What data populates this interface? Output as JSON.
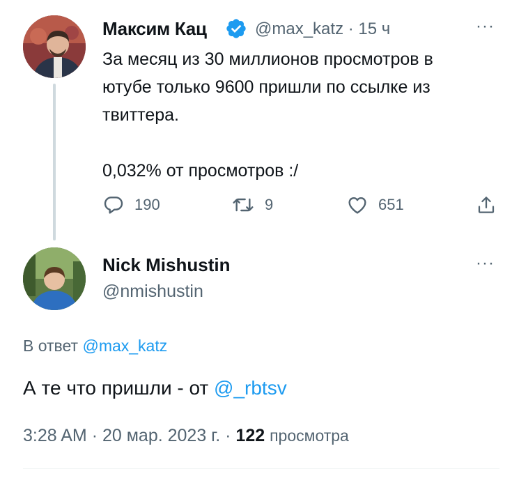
{
  "tweet1": {
    "author_name": "Максим Кац",
    "handle": "@max_katz",
    "separator": "·",
    "time_ago": "15 ч",
    "text": "За месяц из 30 миллионов просмотров в\nютубе только 9600 пришли по ссылке из\nтвиттера.\n\n0,032% от просмотров :/",
    "replies": "190",
    "retweets": "9",
    "likes": "651"
  },
  "tweet2": {
    "author_name": "Nick Mishustin",
    "handle": "@nmishustin",
    "reply_to_label": "В ответ",
    "reply_to_handle": "@max_katz",
    "text_before": "А те что пришли - от",
    "mention": "@_rbtsv",
    "time": "3:28 AM",
    "date": "20 мар. 2023 г.",
    "separator": "·",
    "views_count": "122",
    "views_label": "просмотра"
  },
  "more_label": "···",
  "colors": {
    "accent": "#1d9bf0",
    "secondary_text": "#536471",
    "primary_text": "#0f1419",
    "thread_line": "#cfd9de"
  },
  "icons": [
    "verified-badge-icon",
    "reply-icon",
    "retweet-icon",
    "like-icon",
    "share-icon",
    "more-icon"
  ]
}
